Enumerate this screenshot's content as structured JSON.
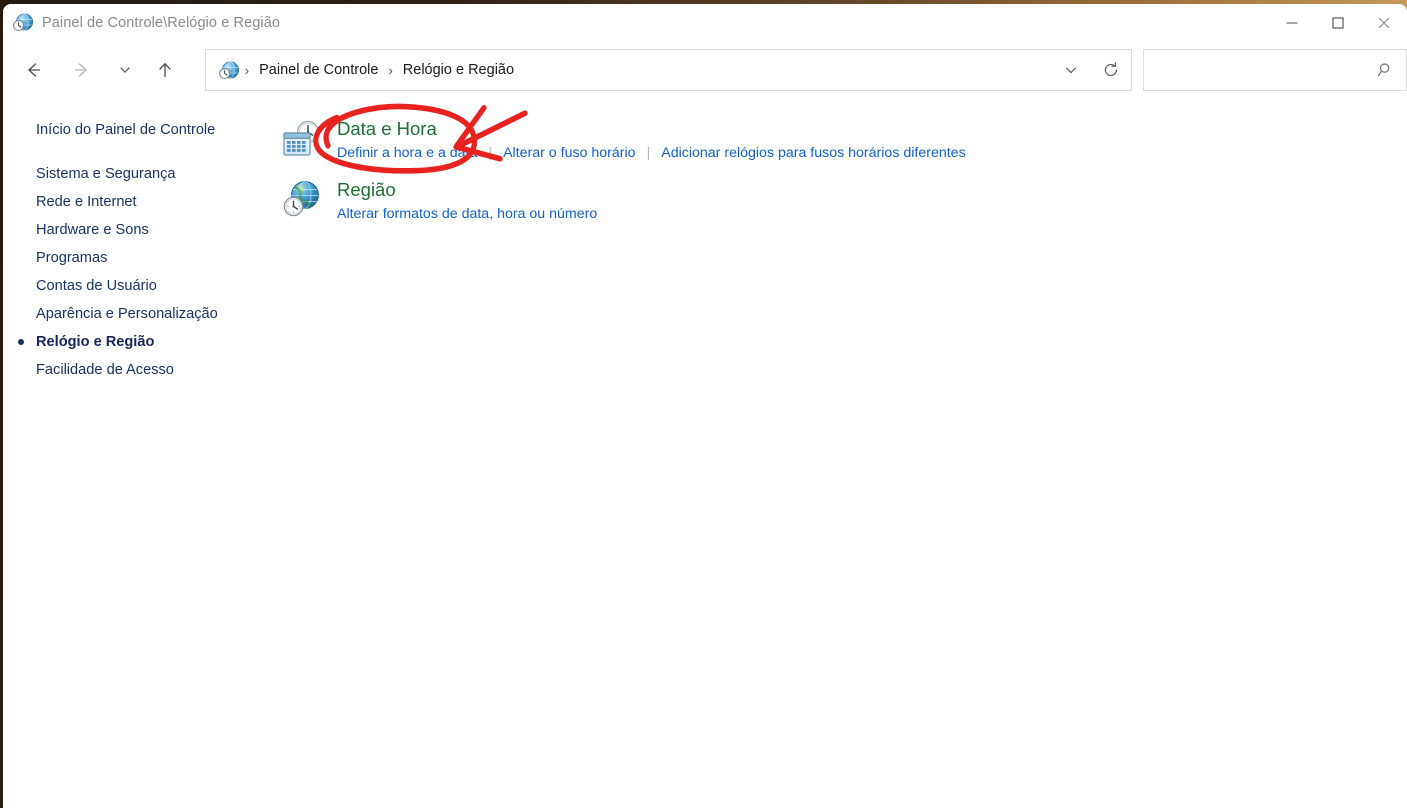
{
  "window": {
    "title": "Painel de Controle\\Relógio e Região",
    "title_icon": "globe-clock-icon",
    "caption": {
      "minimize": "—",
      "maximize": "▢",
      "close": "✕"
    }
  },
  "toolbar": {
    "back": "back-arrow-icon",
    "forward": "forward-arrow-icon",
    "recent": "chevron-down-icon",
    "up": "up-arrow-icon",
    "refresh": "refresh-icon",
    "address_chevron": "chevron-down-icon",
    "breadcrumb": {
      "icon": "control-panel-clock-icon",
      "separator": "›",
      "items": [
        {
          "label": "Painel de Controle"
        },
        {
          "label": "Relógio e Região"
        }
      ]
    },
    "search": {
      "value": "",
      "placeholder": "",
      "icon": "search-icon"
    }
  },
  "sidebar": {
    "home": {
      "label": "Início do Painel de Controle"
    },
    "items": [
      {
        "label": "Sistema e Segurança",
        "current": false
      },
      {
        "label": "Rede e Internet",
        "current": false
      },
      {
        "label": "Hardware e Sons",
        "current": false
      },
      {
        "label": "Programas",
        "current": false
      },
      {
        "label": "Contas de Usuário",
        "current": false
      },
      {
        "label": "Aparência e Personalização",
        "current": false
      },
      {
        "label": "Relógio e Região",
        "current": true
      },
      {
        "label": "Facilidade de Acesso",
        "current": false
      }
    ]
  },
  "content": {
    "categories": [
      {
        "icon": "calendar-clock-icon",
        "title": "Data e Hora",
        "links": [
          "Definir a hora e a data",
          "Alterar o fuso horário",
          "Adicionar relógios para fusos horários diferentes"
        ]
      },
      {
        "icon": "globe-clock-icon",
        "title": "Região",
        "links": [
          "Alterar formatos de data, hora ou número"
        ]
      }
    ]
  },
  "annotation": {
    "type": "handdrawn-red-marker",
    "shapes": [
      "ellipse-around-data-e-hora",
      "arrow-pointing-to-data-e-hora"
    ],
    "color": "#e8231f"
  },
  "colors": {
    "category_title": "#1d7034",
    "category_link": "#1261c9",
    "sidebar_text": "#1a3263",
    "annotation": "#e8231f",
    "window_bg": "#ffffff"
  }
}
